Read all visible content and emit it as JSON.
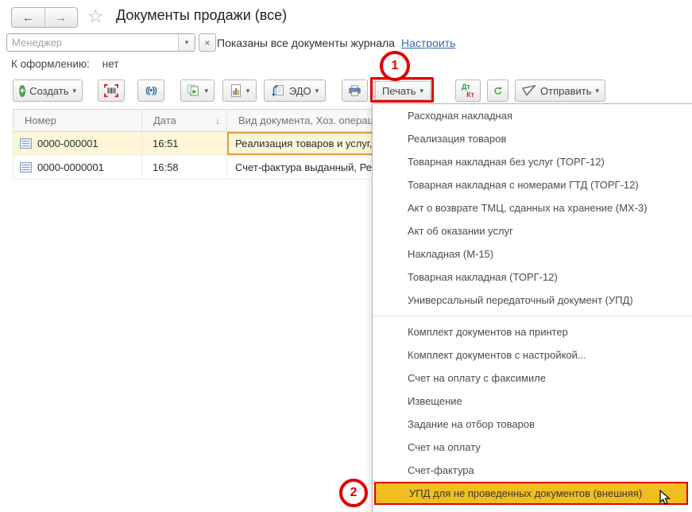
{
  "window": {
    "title": "Документы продажи (все)"
  },
  "icons": {
    "back": "←",
    "forward": "→",
    "favorite": "☆",
    "dropdown": "▾",
    "clear": "×",
    "plus": "+",
    "sort_desc": "↓",
    "interval": "((•))",
    "dt": "Дт",
    "kt": "Кт"
  },
  "filter": {
    "manager_placeholder": "Менеджер",
    "status_text": "Показаны все документы журнала",
    "configure_link": "Настроить"
  },
  "queue": {
    "label": "К оформлению:",
    "value": "нет"
  },
  "toolbar": {
    "create_label": "Создать",
    "edo_label": "ЭДО",
    "print_label": "Печать",
    "send_label": "Отправить"
  },
  "table": {
    "columns": [
      {
        "label": "Номер"
      },
      {
        "label": "Дата",
        "sort_icon": "↓"
      },
      {
        "label": "Вид документа, Хоз. операци"
      }
    ],
    "rows": [
      {
        "number": "0000-000001",
        "time": "16:51",
        "doc_type": "Реализация товаров и услуг,"
      },
      {
        "number": "0000-0000001",
        "time": "16:58",
        "doc_type": "Счет-фактура выданный, Реа"
      }
    ]
  },
  "print_menu": {
    "items": [
      {
        "label": "Расходная накладная"
      },
      {
        "label": "Реализация товаров"
      },
      {
        "label": "Товарная накладная без услуг (ТОРГ-12)"
      },
      {
        "label": "Товарная накладная с номерами ГТД (ТОРГ-12)"
      },
      {
        "label": "Акт о возврате ТМЦ, сданных на хранение (МХ-3)"
      },
      {
        "label": "Акт об оказании услуг"
      },
      {
        "label": "Накладная (М-15)"
      },
      {
        "label": "Товарная накладная (ТОРГ-12)"
      },
      {
        "label": "Универсальный передаточный документ (УПД)"
      },
      {
        "label": "Комплект документов на принтер"
      },
      {
        "label": "Комплект документов с настройкой..."
      },
      {
        "label": "Счет на оплату с факсимиле"
      },
      {
        "label": "Извещение"
      },
      {
        "label": "Задание на отбор товаров"
      },
      {
        "label": "Счет на оплату"
      },
      {
        "label": "Счет-фактура"
      },
      {
        "label": "УПД для не проведенных документов (внешняя)",
        "highlighted": true
      }
    ]
  },
  "annotations": {
    "step_1": "1",
    "step_2": "2"
  },
  "colors": {
    "annotation_red": "#e00000",
    "menu_highlight_gold": "#f0be1e",
    "selected_row_yellow": "#fdf6d8",
    "active_cell_border": "#d9a43b",
    "link_blue": "#3a66ad"
  }
}
